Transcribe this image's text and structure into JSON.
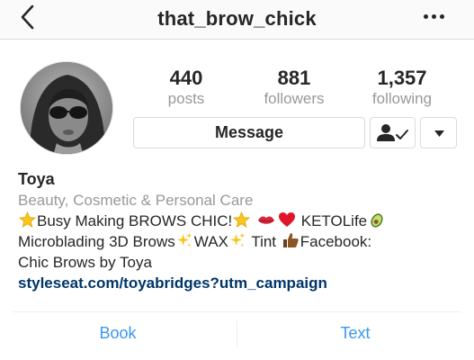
{
  "header": {
    "username": "that_brow_chick"
  },
  "stats": {
    "posts": {
      "count": "440",
      "label": "posts"
    },
    "followers": {
      "count": "881",
      "label": "followers"
    },
    "following": {
      "count": "1,357",
      "label": "following"
    }
  },
  "buttons": {
    "message_label": "Message"
  },
  "bio": {
    "name": "Toya",
    "category": "Beauty, Cosmetic & Personal Care",
    "line1_a": "Busy Making BROWS CHIC!",
    "line1_b": "KETOLife",
    "line2_a": "Microblading 3D Brows",
    "line2_b": "WAX",
    "line2_c": "Tint",
    "line2_d": "Facebook:",
    "line3": "Chic Brows by Toya",
    "link": "styleseat.com/toyabridges?utm_campaign"
  },
  "actions": {
    "book_label": "Book",
    "text_label": "Text"
  },
  "icons": {
    "back": "chevron-left-icon",
    "more": "ellipsis-icon",
    "follow_status": "person-check-icon",
    "dropdown": "caret-down-icon",
    "emoji": [
      "star-emoji",
      "kiss-lips-emoji",
      "red-heart-emoji",
      "avocado-emoji",
      "sparkles-emoji",
      "thumbs-up-emoji"
    ]
  },
  "colors": {
    "link_blue": "#003569",
    "action_blue": "#3897f0",
    "secondary_gray": "#999999",
    "border": "#dbdbdb"
  }
}
